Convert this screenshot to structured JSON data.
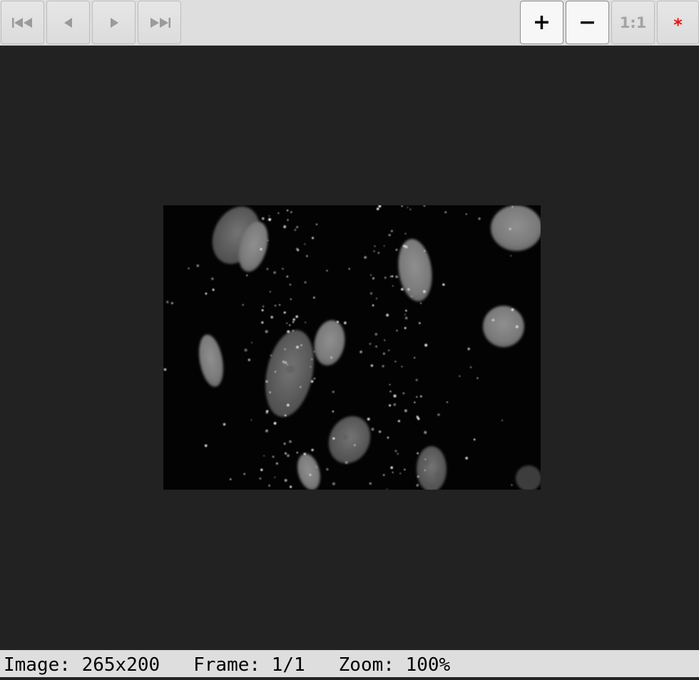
{
  "toolbar": {
    "buttons": [
      {
        "name": "first-frame",
        "icon": "skip-to-first-icon",
        "state": "disabled"
      },
      {
        "name": "previous-frame",
        "icon": "previous-triangle-icon",
        "state": "disabled"
      },
      {
        "name": "next-frame",
        "icon": "next-triangle-icon",
        "state": "disabled"
      },
      {
        "name": "last-frame",
        "icon": "skip-to-last-icon",
        "state": "disabled"
      },
      {
        "name": "zoom-in",
        "glyph": "+",
        "state": "active"
      },
      {
        "name": "zoom-out",
        "glyph": "−",
        "state": "active"
      },
      {
        "name": "actual-size",
        "glyph": "1:1",
        "state": "disabled"
      },
      {
        "name": "auto-fit",
        "glyph": "*",
        "state": "disabled",
        "color": "#ee1111"
      }
    ]
  },
  "viewer": {
    "background": "#222222",
    "image_alt": "Grayscale fluorescence microscopy image of cell nuclei with bright dot spots"
  },
  "status": {
    "image_label": "Image:",
    "image_size": "265x200",
    "frame_label": "Frame:",
    "frame_value": "1/1",
    "zoom_label": "Zoom:",
    "zoom_value": "100%"
  }
}
